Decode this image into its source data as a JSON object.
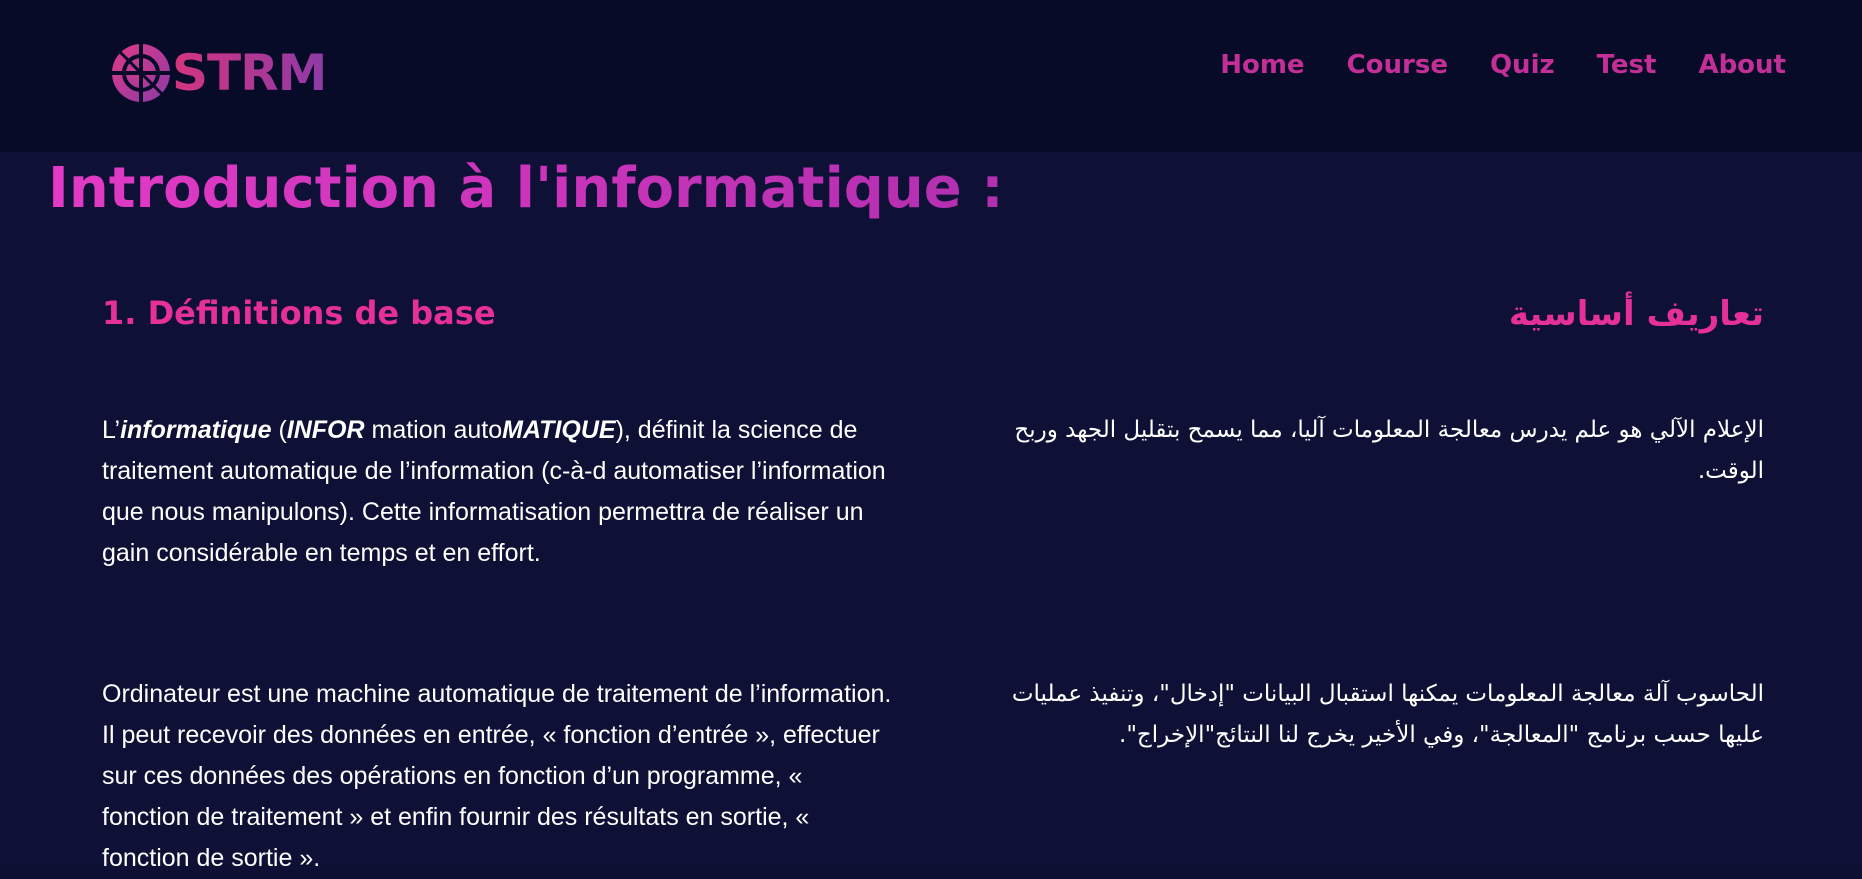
{
  "brand": {
    "logo_text": "STRM",
    "icon": "crosshair-target-icon",
    "gradient": [
      "#d4357e",
      "#8e3aa7"
    ]
  },
  "nav": {
    "items": [
      {
        "label": "Home"
      },
      {
        "label": "Course"
      },
      {
        "label": "Quiz"
      },
      {
        "label": "Test"
      },
      {
        "label": "About"
      }
    ],
    "color": "#c32e97"
  },
  "page": {
    "title": "Introduction à l'informatique :"
  },
  "section": {
    "title_fr": "1. Définitions de base",
    "title_ar": "تعاريف أساسية"
  },
  "paragraph1": {
    "fr": {
      "prefix": "L’",
      "bold1": "informatique",
      "mid1": " (",
      "bold2": "INFOR",
      "mid2": " mation auto",
      "bold3": "MATIQUE",
      "rest": "), définit la science de traitement automatique de l’information (c-à-d automatiser l’information que nous manipulons). Cette informatisation permettra de réaliser un gain considérable en temps et en effort."
    },
    "ar": "الإعلام الآلي هو علم يدرس معالجة المعلومات آليا، مما يسمح بتقليل الجهد وربح الوقت."
  },
  "paragraph2": {
    "fr": "Ordinateur est une machine automatique de traitement de l’information. Il peut recevoir des données en entrée, « fonction d’entrée », effectuer sur ces données des opérations en fonction d’un programme, « fonction de traitement » et enfin fournir des résultats en sortie, « fonction de sortie ».",
    "ar": "الحاسوب آلة معالجة المعلومات يمكنها استقبال البيانات \"إدخال\"، وتنفيذ عمليات عليها حسب برنامج \"المعالجة\"، وفي الأخير يخرج لنا النتائج\"الإخراج\"."
  },
  "colors": {
    "background": "#0e1035",
    "header_background": "#080b27",
    "accent": "#e5309a"
  }
}
